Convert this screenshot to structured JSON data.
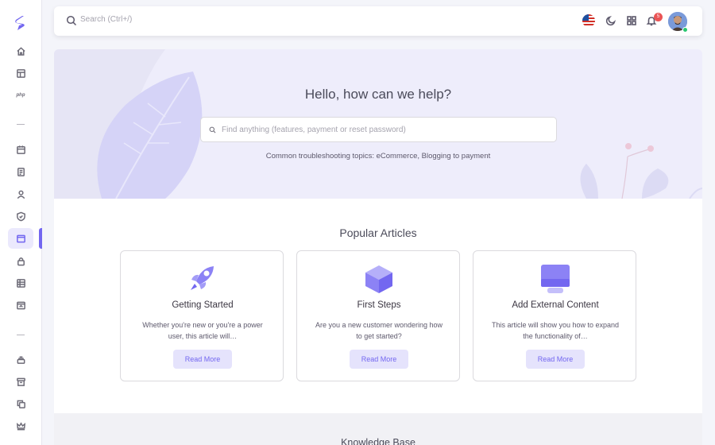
{
  "sidebar": {
    "logo": "brand-logo",
    "php_label": "php",
    "items": [
      {
        "name": "home-icon"
      },
      {
        "name": "layout-icon"
      },
      {
        "name": "calendar-icon"
      },
      {
        "name": "file-text-icon"
      },
      {
        "name": "user-icon"
      },
      {
        "name": "shield-check-icon"
      },
      {
        "name": "browser-icon",
        "active": true
      },
      {
        "name": "lock-icon"
      },
      {
        "name": "table-icon"
      },
      {
        "name": "app-window-icon"
      },
      {
        "name": "stack-icon"
      },
      {
        "name": "archive-icon"
      },
      {
        "name": "copy-icon"
      },
      {
        "name": "crown-icon"
      }
    ],
    "accent": "#7367f0"
  },
  "navbar": {
    "search_placeholder": "Search (Ctrl+/)",
    "notification_count": "5",
    "icons": [
      "search-icon",
      "us-flag-icon",
      "moon-icon",
      "grid-icon",
      "bell-icon",
      "avatar"
    ]
  },
  "hero": {
    "title": "Hello, how can we help?",
    "search_placeholder": "Find anything (features, payment or reset password)",
    "topics": "Common troubleshooting topics: eCommerce, Blogging to payment"
  },
  "popular": {
    "title": "Popular Articles",
    "articles": [
      {
        "title": "Getting Started",
        "description": "Whether you're new or you're a power user, this article will…",
        "button": "Read More",
        "icon": "rocket-icon"
      },
      {
        "title": "First Steps",
        "description": "Are you a new customer wondering how to get started?",
        "button": "Read More",
        "icon": "cube-icon"
      },
      {
        "title": "Add External Content",
        "description": "This article will show you how to expand the functionality of…",
        "button": "Read More",
        "icon": "monitor-icon"
      }
    ]
  },
  "knowledge_base": {
    "title": "Knowledge Base"
  }
}
